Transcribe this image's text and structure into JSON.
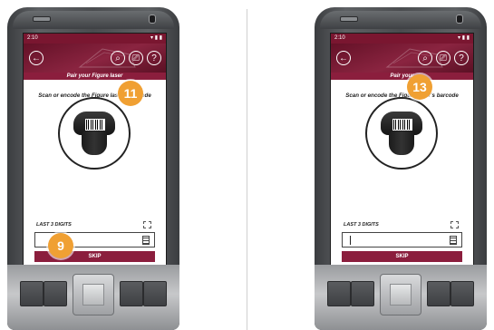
{
  "colors": {
    "brand": "#8b1e3d",
    "callout": "#f0a033"
  },
  "devices": [
    {
      "status": {
        "time": "2:10"
      },
      "title": "Pair your Figure laser",
      "instruction": "Scan or encode the Figure laser's barcode",
      "digits_label": "LAST 3 DIGITS",
      "skip_label": "SKIP",
      "callouts": [
        "11",
        "9"
      ]
    },
    {
      "status": {
        "time": "2:10"
      },
      "title": "Pair your",
      "instruction": "Scan or encode the Figure laser's barcode",
      "digits_label": "LAST 3 DIGITS",
      "skip_label": "SKIP",
      "callouts": [
        "13"
      ]
    }
  ],
  "icons": {
    "back": "back-arrow-icon",
    "search": "search-icon",
    "scan": "barcode-scan-icon",
    "help": "help-icon",
    "keyboard": "keyboard-icon"
  }
}
